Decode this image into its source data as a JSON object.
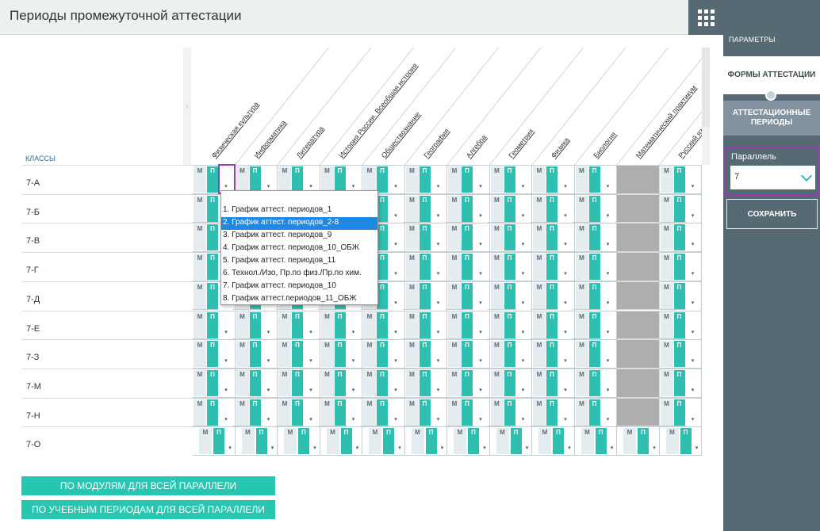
{
  "page": {
    "title": "Периоды промежуточной аттестации"
  },
  "side": {
    "section_label": "ПАРАМЕТРЫ",
    "tab_forms": "ФОРМЫ АТТЕСТАЦИИ",
    "tab_periods": "АТТЕСТАЦИОННЫЕ ПЕРИОДЫ",
    "parallel_label": "Параллель",
    "parallel_value": "7",
    "save": "СОХРАНИТЬ"
  },
  "table": {
    "classes_label": "КЛАССЫ",
    "subjects": [
      "Физическая культура",
      "Информатика",
      "Литература",
      "История России. Всеобщая история",
      "Обществознание",
      "География",
      "Алгебра",
      "Геометрия",
      "Физика",
      "Биология",
      "Математический практикум",
      "Русский язык"
    ],
    "rows": [
      "7-А",
      "7-Б",
      "7-В",
      "7-Г",
      "7-Д",
      "7-Е",
      "7-З",
      "7-М",
      "7-Н",
      "7-О"
    ],
    "cell": {
      "m": "М",
      "p": "П",
      "arrow": "▾"
    }
  },
  "dropdown": {
    "options": [
      "1. График аттест. периодов_1",
      "2. График аттест. периодов_2-8",
      "3. График аттест. периодов_9",
      "4. График аттест. периодов_10_ОБЖ",
      "5. График аттест. периодов_11",
      "6. Технол./Изо, Пр.по физ./Пр.по хим.",
      "7. График аттест. периодов_10",
      "8. График аттест.периодов_11_ОБЖ"
    ],
    "selected_index": 1
  },
  "buttons": {
    "by_modules": "ПО МОДУЛЯМ ДЛЯ ВСЕЙ ПАРАЛЛЕЛИ",
    "by_periods": "ПО УЧЕБНЫМ ПЕРИОДАМ ДЛЯ ВСЕЙ ПАРАЛЛЕЛИ"
  },
  "colors": {
    "accent": "#26c6b0",
    "sidebar": "#566a74",
    "highlight": "#9b3bb5",
    "selected": "#1e88e5"
  }
}
